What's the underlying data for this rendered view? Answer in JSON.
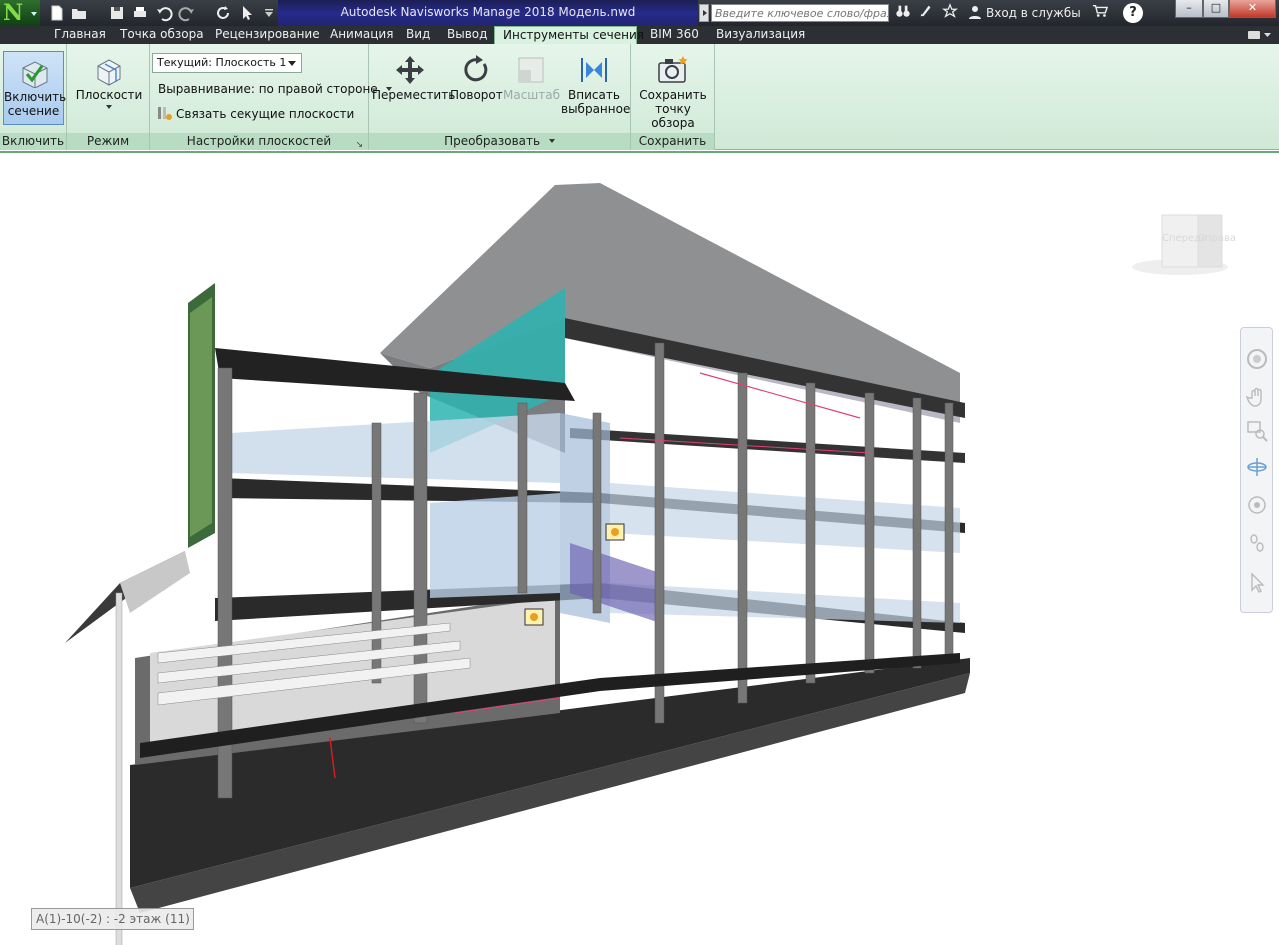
{
  "window": {
    "title": "Autodesk Navisworks Manage 2018    Модель.nwd",
    "search_placeholder": "Введите ключевое слово/фразу",
    "sign_in": "Вход в службы",
    "help": "?",
    "minimize": "–",
    "maximize": "□",
    "close": "✕"
  },
  "tabs": [
    {
      "label": "Главная"
    },
    {
      "label": "Точка обзора"
    },
    {
      "label": "Рецензирование"
    },
    {
      "label": "Анимация"
    },
    {
      "label": "Вид"
    },
    {
      "label": "Вывод"
    },
    {
      "label": "Инструменты сечения",
      "active": true
    },
    {
      "label": "BIM 360"
    },
    {
      "label": "Визуализация"
    }
  ],
  "ribbon": {
    "enable": {
      "button_line1": "Включить",
      "button_line2": "сечение",
      "panel": "Включить",
      "pressed": true
    },
    "mode": {
      "button": "Плоскости",
      "panel": "Режим"
    },
    "plane_settings": {
      "current": "Текущий: Плоскость 1",
      "alignment": "Выравнивание: по правой стороне",
      "link": "Связать секущие плоскости",
      "panel": "Настройки плоскостей"
    },
    "transform": {
      "move": "Переместить",
      "rotate": "Поворот",
      "scale": "Масштаб",
      "fit_line1": "Вписать",
      "fit_line2": "выбранное",
      "panel": "Преобразовать"
    },
    "save": {
      "button_line1": "Сохранить",
      "button_line2": "точку обзора",
      "panel": "Сохранить"
    }
  },
  "viewcube": {
    "front": "Спереди",
    "right": "Справа"
  },
  "status": {
    "selection": "A(1)-10(-2) : -2 этаж (11)"
  },
  "colors": {
    "ribbon_bg": "#d9f2df",
    "panel_label": "#b7dcc2",
    "active_tab": "#d9f2df",
    "title_bg": "#272a8a"
  }
}
